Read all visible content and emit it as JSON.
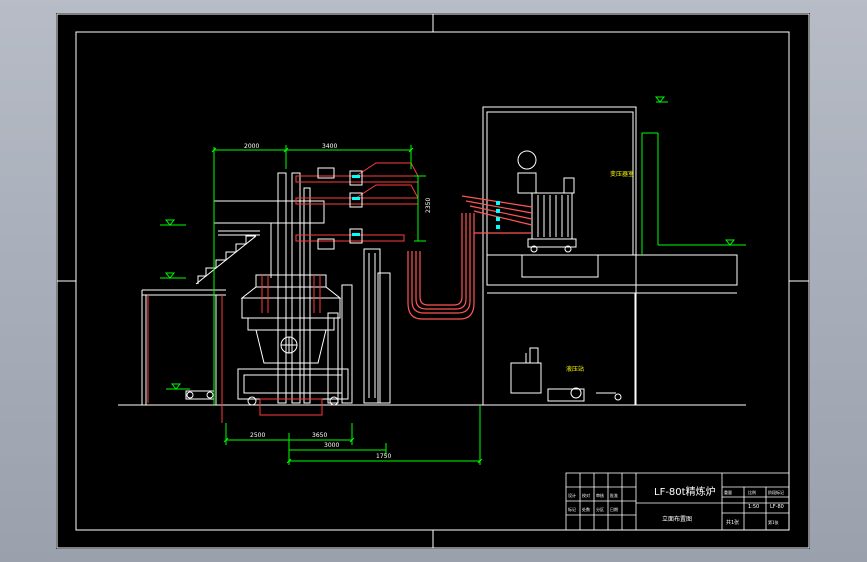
{
  "viewport": {
    "background": "#000000",
    "frame_color": "#ffffff"
  },
  "colors": {
    "dimension": "#00ff00",
    "structure": "#ffffff",
    "steel": "#ff3b3b",
    "equipment": "#ffffff",
    "cable": "#ff5555",
    "label": "#ffff00",
    "secondary": "#00ffff"
  },
  "dimensions": {
    "top_left": "2000",
    "top_right": "3400",
    "vertical": "2350",
    "bottom_a": "2500",
    "bottom_b": "3650",
    "bottom_c": "3000",
    "bottom_d": "1750"
  },
  "labels": {
    "transformer_room": "变压器室",
    "hydraulic_station": "液压站"
  },
  "title_block": {
    "title": "LF-80t精炼炉",
    "subtitle": "立面布置图",
    "drawing_no": "LF-80",
    "scale": "1:50",
    "sheet": "共1张",
    "row_labels": [
      "设计",
      "校对",
      "审核",
      "批准",
      "标记",
      "处数",
      "分区",
      "日期"
    ],
    "cells": [
      "重量",
      "比例",
      "阶段标记",
      "第1张"
    ]
  }
}
